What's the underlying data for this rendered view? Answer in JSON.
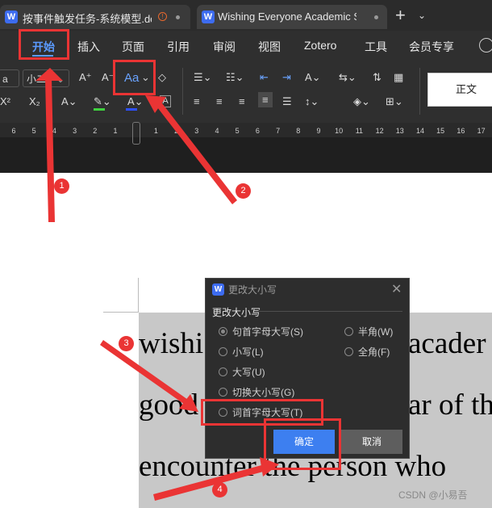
{
  "tabs": [
    {
      "title": "按事件触发任务-系统模型.doc",
      "icon": "W",
      "unsaved": "!"
    },
    {
      "title": "Wishing Everyone Academic Success",
      "icon": "W"
    }
  ],
  "menu": [
    "开始",
    "插入",
    "页面",
    "引用",
    "审阅",
    "视图",
    "Zotero",
    "工具",
    "会员专享"
  ],
  "ribbon": {
    "font_name": "a",
    "font_size": "小二",
    "grow_font": "A⁺",
    "shrink_font": "A⁻",
    "change_case": "Aa",
    "subscript": "X₂",
    "superscript": "X²",
    "style_normal": "正文"
  },
  "ruler_ticks": [
    "6",
    "5",
    "4",
    "3",
    "2",
    "1",
    "",
    "1",
    "2",
    "3",
    "4",
    "5",
    "6",
    "7",
    "8",
    "9",
    "10",
    "11",
    "12",
    "13",
    "14",
    "15",
    "16",
    "17"
  ],
  "document": {
    "line1": "wishi",
    "line1_right": "acader",
    "line2": "good",
    "line2_right": "ar of th",
    "line3": "encounter the person who"
  },
  "dialog": {
    "title": "更改大小写",
    "group": "更改大小写",
    "options_left": [
      "句首字母大写(S)",
      "小写(L)",
      "大写(U)",
      "切换大小写(G)",
      "词首字母大写(T)"
    ],
    "options_right": [
      "半角(W)",
      "全角(F)"
    ],
    "selected": "句首字母大写(S)",
    "ok": "确定",
    "cancel": "取消"
  },
  "annotations": [
    "1",
    "2",
    "3",
    "4"
  ],
  "colors": {
    "annotation": "#ea3434",
    "accent": "#5b9bff",
    "ok_button": "#3d7ff0"
  },
  "watermark": "CSDN @小易吾"
}
